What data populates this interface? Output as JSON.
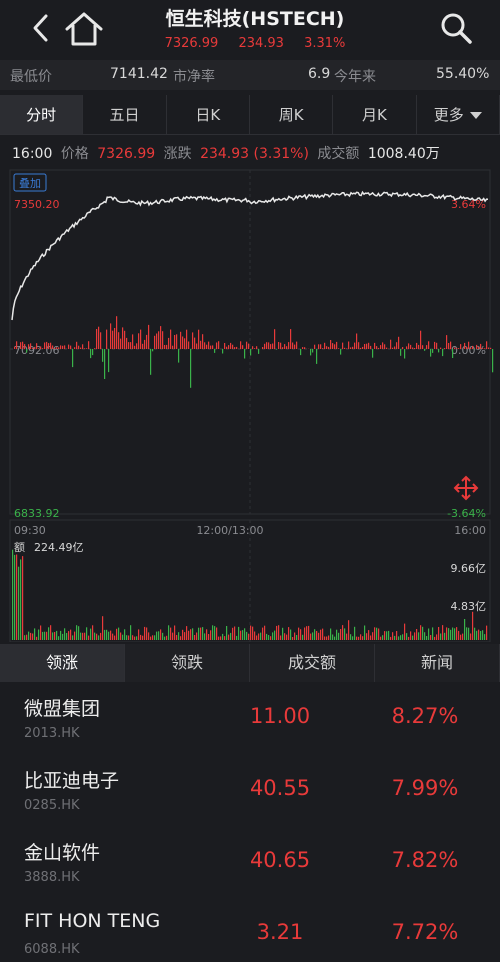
{
  "header": {
    "title": "恒生科技(HSTECH)",
    "price": "7326.99",
    "change": "234.93",
    "change_pct": "3.31%"
  },
  "stats": {
    "low_label": "最低价",
    "low_value": "7141.42",
    "pb_label": "市净率",
    "pb_value": "6.9",
    "ytd_label": "今年来",
    "ytd_value": "55.40%"
  },
  "period_tabs": [
    "分时",
    "五日",
    "日K",
    "周K",
    "月K",
    "更多"
  ],
  "info": {
    "time": "16:00",
    "price_label": "价格",
    "price": "7326.99",
    "change_label": "涨跌",
    "change": "234.93 (3.31%)",
    "volume_label": "成交额",
    "volume": "1008.40万"
  },
  "chart": {
    "overlay_label": "叠加",
    "y_max": "7350.20",
    "y_mid": "7092.06",
    "y_min": "6833.92",
    "pct_max": "3.64%",
    "pct_mid": "0.00%",
    "pct_min": "-3.64%",
    "time_start": "09:30",
    "time_mid": "12:00/13:00",
    "time_end": "16:00",
    "amount_label": "额",
    "amount_value": "224.49亿",
    "vol_high": "9.66亿",
    "vol_mid": "4.83亿"
  },
  "list_tabs": [
    "领涨",
    "领跌",
    "成交额",
    "新闻"
  ],
  "stocks": [
    {
      "name": "微盟集团",
      "code": "2013.HK",
      "price": "11.00",
      "pct": "8.27%"
    },
    {
      "name": "比亚迪电子",
      "code": "0285.HK",
      "price": "40.55",
      "pct": "7.99%"
    },
    {
      "name": "金山软件",
      "code": "3888.HK",
      "price": "40.65",
      "pct": "7.82%"
    },
    {
      "name": "FIT HON TENG",
      "code": "6088.HK",
      "price": "3.21",
      "pct": "7.72%"
    }
  ],
  "colors": {
    "up": "#e83a3a",
    "down": "#3ab24a",
    "background": "#1b1c20",
    "price_line": "#e8e8e8"
  }
}
